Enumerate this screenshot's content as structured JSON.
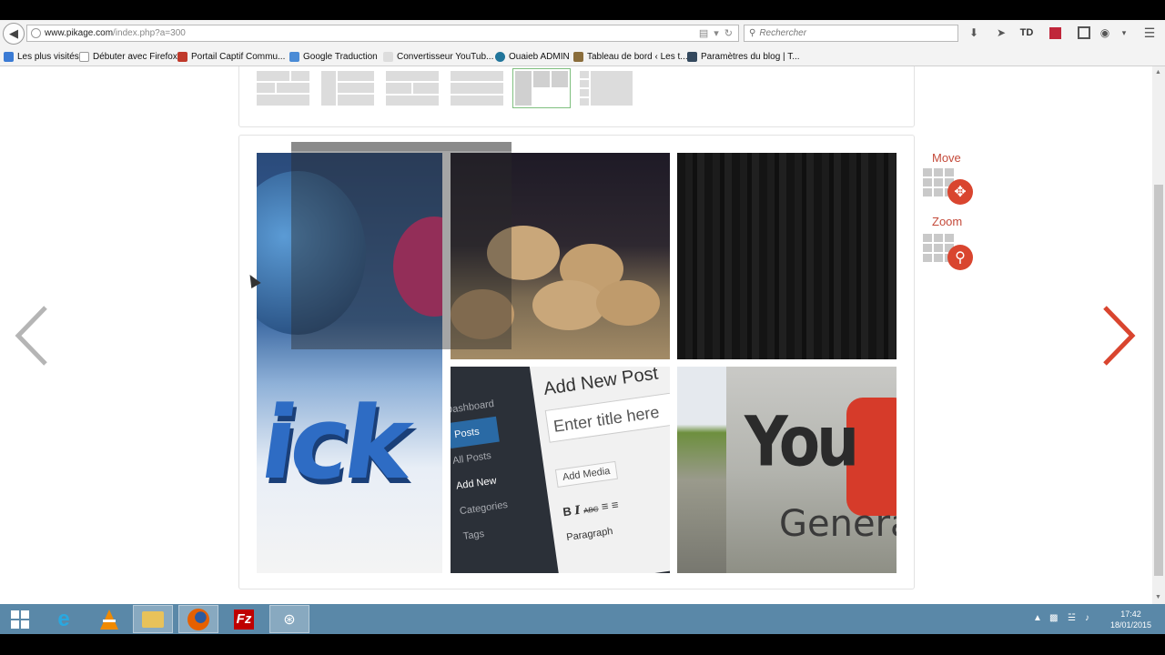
{
  "browser": {
    "url_host": "www.pikage.com",
    "url_path": "/index.php?a=300",
    "search_placeholder": "Rechercher",
    "bookmarks": [
      {
        "label": "Les plus visités",
        "color": "#3b7bd4"
      },
      {
        "label": "Débuter avec Firefox",
        "color": "#ffffff"
      },
      {
        "label": "Portail Captif Commu...",
        "color": "#c0392b"
      },
      {
        "label": "Google Traduction",
        "color": "#4a8bd6"
      },
      {
        "label": "Convertisseur YouTub...",
        "color": "#dddddd"
      },
      {
        "label": "Ouaieb ADMIN",
        "color": "#21759b"
      },
      {
        "label": "Tableau de bord ‹ Les t...",
        "color": "#8a6d3b"
      },
      {
        "label": "Paramètres du blog | T...",
        "color": "#34495e"
      }
    ]
  },
  "editor": {
    "tools": {
      "move_label": "Move",
      "zoom_label": "Zoom"
    },
    "accent_color": "#d9452f",
    "photos": {
      "wordpress_title": "Add New Post",
      "wordpress_placeholder": "Enter title here",
      "wordpress_media": "Add Media",
      "wordpress_paragraph": "Paragraph",
      "wordpress_menu_dashboard": "Dashboard",
      "wordpress_menu_posts": "Posts",
      "wordpress_menu_allposts": "All Posts",
      "wordpress_menu_addnew": "Add New",
      "wordpress_menu_categories": "Categories",
      "wordpress_menu_tags": "Tags",
      "wordpress_toolbar_abc": "ABC",
      "youtube_text": "You",
      "youtube_general": "Genera",
      "flickr_text": "ick"
    }
  },
  "taskbar": {
    "time": "17:42",
    "date": "18/01/2015"
  }
}
